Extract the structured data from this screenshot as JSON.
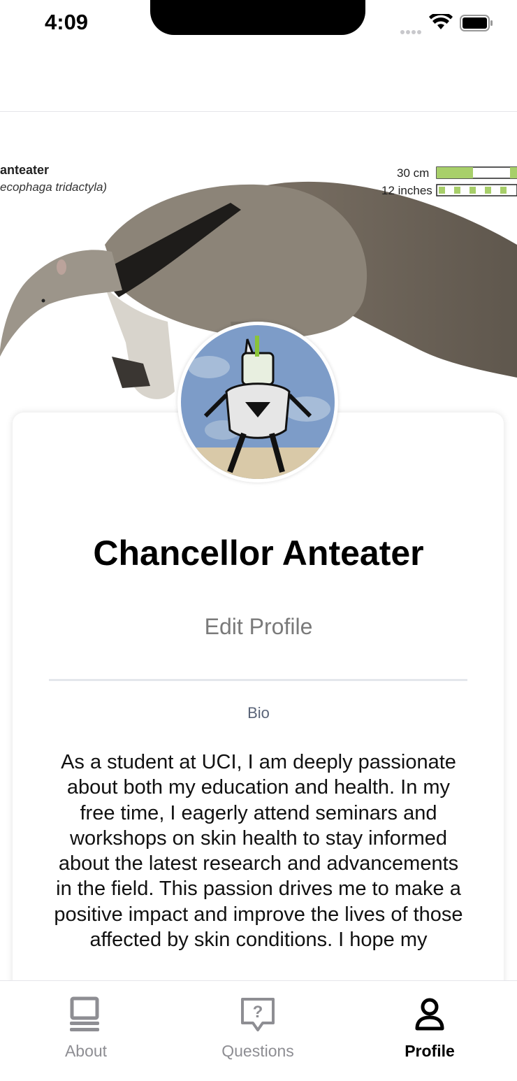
{
  "status_bar": {
    "time": "4:09"
  },
  "hero": {
    "title": "anteater",
    "scientific_name": "ecophaga tridactyla)",
    "scale_metric": "30 cm",
    "scale_imperial": "12 inches"
  },
  "profile": {
    "name": "Chancellor Anteater",
    "edit_label": "Edit Profile",
    "bio_label": "Bio",
    "bio_text": "As a student at UCI, I am deeply passionate about both my education and health. In my free time, I eagerly attend seminars and workshops on skin health to stay informed about the latest research and advancements in the field. This passion drives me to make a positive impact and improve the lives of those affected by skin conditions. I hope my"
  },
  "tabs": [
    {
      "label": "About",
      "icon": "laptop-icon",
      "active": false
    },
    {
      "label": "Questions",
      "icon": "question-bubble-icon",
      "active": false
    },
    {
      "label": "Profile",
      "icon": "person-icon",
      "active": true
    }
  ],
  "colors": {
    "active_tab": "#000000",
    "inactive_tab": "#8e8e93",
    "scale_green": "#a8cf6a"
  }
}
